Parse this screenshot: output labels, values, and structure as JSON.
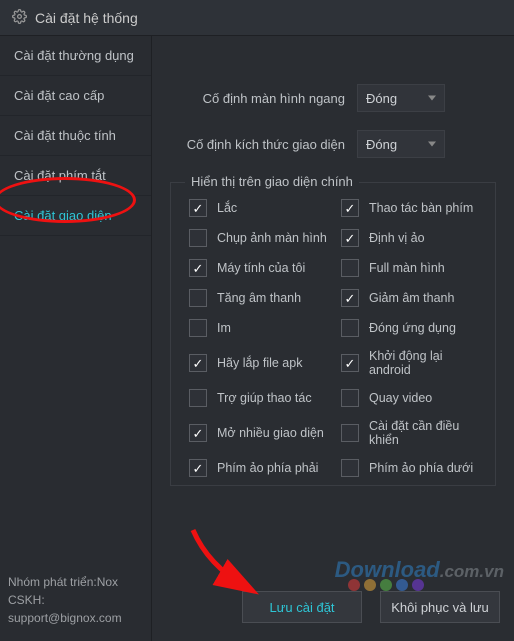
{
  "titlebar": {
    "title": "Cài đặt hệ thống"
  },
  "sidebar": {
    "items": [
      {
        "label": "Cài đặt thường dụng"
      },
      {
        "label": "Cài đặt cao cấp"
      },
      {
        "label": "Cài đặt thuộc tính"
      },
      {
        "label": "Cài đặt phím tắt"
      },
      {
        "label": "Cài đặt giao diện"
      }
    ],
    "credits": {
      "line1": "Nhóm phát triển:Nox",
      "line2": "CSKH:",
      "line3": "support@bignox.com"
    }
  },
  "content": {
    "row1": {
      "label": "Cố định màn hình ngang",
      "value": "Đóng"
    },
    "row2": {
      "label": "Cố định kích thức giao diện",
      "value": "Đóng"
    },
    "fieldset": {
      "legend": "Hiển thị trên giao diện chính",
      "items": [
        {
          "label": "Lắc",
          "checked": true
        },
        {
          "label": "Thao tác bàn phím",
          "checked": true
        },
        {
          "label": "Chụp ảnh màn hình",
          "checked": false
        },
        {
          "label": "Định vị ảo",
          "checked": true
        },
        {
          "label": "Máy tính của tôi",
          "checked": true
        },
        {
          "label": "Full màn hình",
          "checked": false
        },
        {
          "label": "Tăng âm thanh",
          "checked": false
        },
        {
          "label": "Giảm âm thanh",
          "checked": true
        },
        {
          "label": "Im",
          "checked": false
        },
        {
          "label": "Đóng ứng dụng",
          "checked": false
        },
        {
          "label": "Hãy lắp file apk",
          "checked": true
        },
        {
          "label": "Khởi động lại android",
          "checked": true
        },
        {
          "label": "Trợ giúp thao tác",
          "checked": false
        },
        {
          "label": "Quay video",
          "checked": false
        },
        {
          "label": "Mở nhiều giao diện",
          "checked": true
        },
        {
          "label": "Cài đặt cần điều khiển",
          "checked": false
        },
        {
          "label": "Phím ảo phía phải",
          "checked": true
        },
        {
          "label": "Phím ảo phía dưới",
          "checked": false
        }
      ]
    },
    "buttons": {
      "save": "Lưu cài đặt",
      "restore": "Khôi phục và lưu"
    }
  },
  "watermark": {
    "part1": "Download",
    "part2": ".com.vn"
  },
  "dot_colors": [
    "#e23b3b",
    "#e2a63b",
    "#5bbf4a",
    "#3b7fe2",
    "#7a3be2"
  ]
}
